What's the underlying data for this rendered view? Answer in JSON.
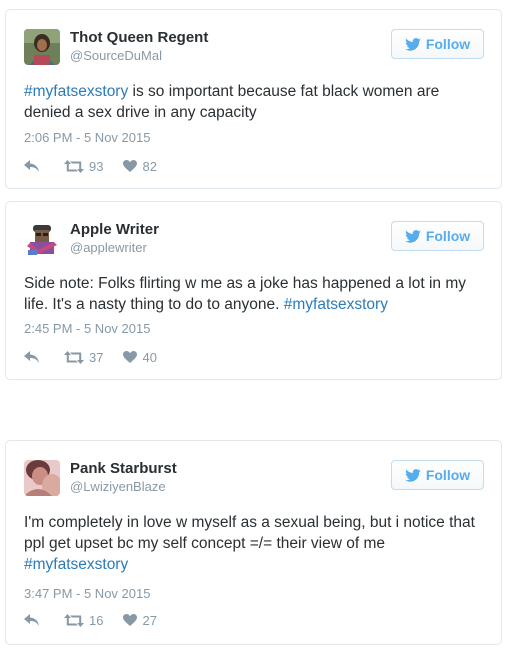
{
  "follow_label": "Follow",
  "colors": {
    "hashtag": "#2b7bb9",
    "follow_blue": "#55acee",
    "meta_gray": "#8899a6",
    "border": "#e1e8ed"
  },
  "tweets": [
    {
      "name": "Thot Queen Regent",
      "handle": "@SourceDuMal",
      "text_hashtag": "#myfatsexstory",
      "text_rest": " is so important because fat black women are denied a sex drive in any capacity",
      "time": "2:06 PM - 5 Nov 2015",
      "retweets": "93",
      "likes": "82",
      "avatar_icon": "profile-photo"
    },
    {
      "name": "Apple Writer",
      "handle": "@applewriter",
      "text_before": "Side note: Folks flirting w me as a joke has happened a lot in my life. It's a nasty thing to do to anyone. ",
      "text_hashtag": "#myfatsexstory",
      "time": "2:45 PM - 5 Nov 2015",
      "retweets": "37",
      "likes": "40",
      "avatar_icon": "cartoon-avatar"
    },
    {
      "name": "Pank Starburst",
      "handle": "@LwiziyenBlaze",
      "text_before": "I'm completely in love w myself as a sexual being, but i notice that ppl get upset bc my self concept =/= their view of me",
      "text_hashtag": "#myfatsexstory",
      "time": "3:47 PM - 5 Nov 2015",
      "retweets": "16",
      "likes": "27",
      "avatar_icon": "profile-photo"
    }
  ]
}
